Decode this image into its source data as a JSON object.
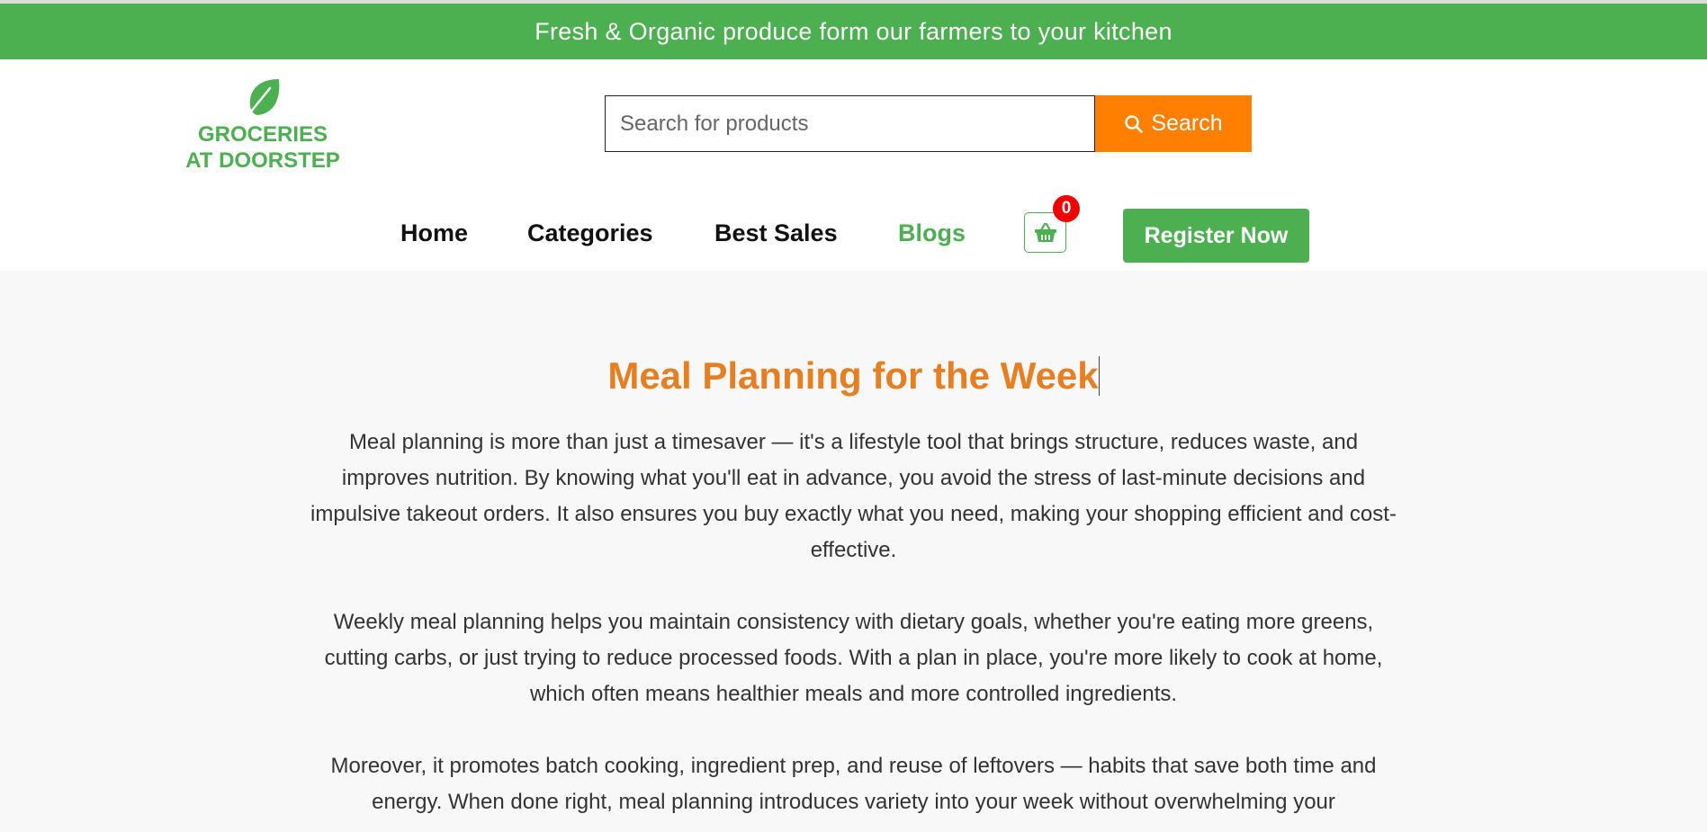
{
  "banner": {
    "text": "Fresh & Organic produce form our farmers to your kitchen"
  },
  "logo": {
    "icon": "leaf-icon",
    "line1": "GROCERIES",
    "line2": "AT DOORSTEP"
  },
  "search": {
    "placeholder": "Search for products",
    "value": "",
    "button_label": "Search",
    "button_icon": "search-icon"
  },
  "nav": {
    "items": [
      {
        "label": "Home",
        "active": false
      },
      {
        "label": "Categories",
        "active": false
      },
      {
        "label": "Best Sales",
        "active": false
      },
      {
        "label": "Blogs",
        "active": true
      }
    ],
    "cart": {
      "icon": "basket-icon",
      "count": "0"
    },
    "register_label": "Register Now"
  },
  "post": {
    "title": "Meal Planning for the Week",
    "paragraphs": [
      "Meal planning is more than just a timesaver — it's a lifestyle tool that brings structure, reduces waste, and improves nutrition. By knowing what you'll eat in advance, you avoid the stress of last-minute decisions and impulsive takeout orders. It also ensures you buy exactly what you need, making your shopping efficient and cost-effective.",
      "Weekly meal planning helps you maintain consistency with dietary goals, whether you're eating more greens, cutting carbs, or just trying to reduce processed foods. With a plan in place, you're more likely to cook at home, which often means healthier meals and more controlled ingredients.",
      "Moreover, it promotes batch cooking, ingredient prep, and reuse of leftovers — habits that save both time and energy. When done right, meal planning introduces variety into your week without overwhelming your"
    ]
  },
  "colors": {
    "brand_green": "#4caf50",
    "accent_orange": "#ff8000",
    "title_orange": "#e67e22",
    "badge_red": "#f20000"
  }
}
